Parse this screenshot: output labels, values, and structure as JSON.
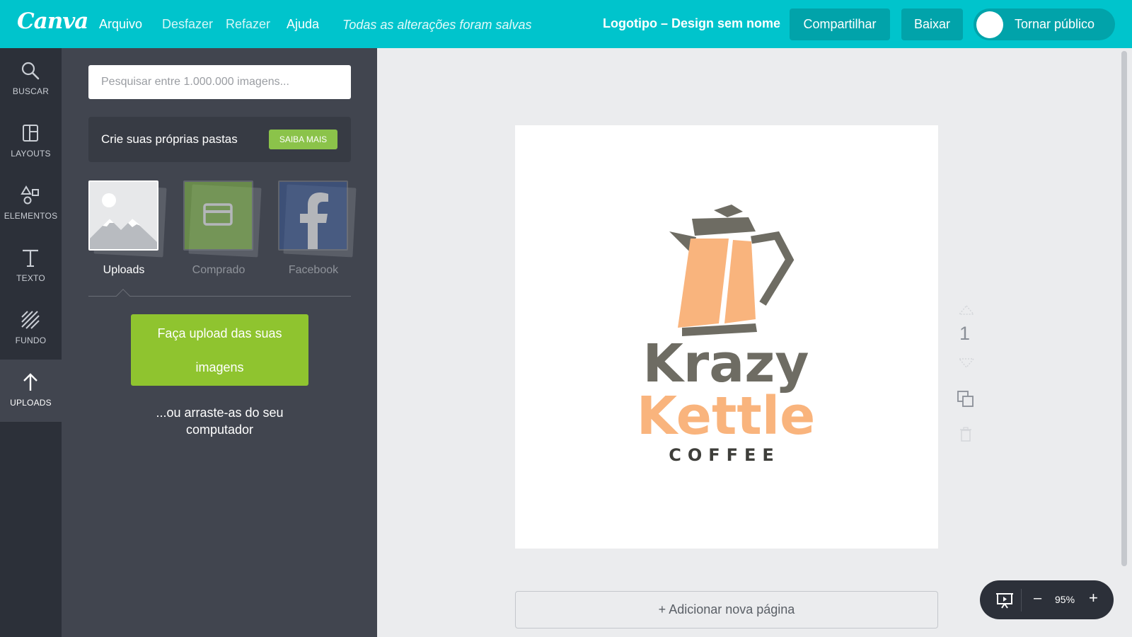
{
  "brand": {
    "logo_text": "Canva"
  },
  "topbar": {
    "menu": [
      "Arquivo",
      "Desfazer",
      "Refazer",
      "Ajuda"
    ],
    "saved_status": "Todas as alterações foram salvas",
    "doc_title": "Logotipo – Design sem nome",
    "share_label": "Compartilhar",
    "download_label": "Baixar",
    "public_toggle_label": "Tornar público",
    "accent_color": "#00c4cc"
  },
  "leftnav": {
    "items": [
      {
        "label": "BUSCAR",
        "icon": "search-icon"
      },
      {
        "label": "LAYOUTS",
        "icon": "layouts-icon"
      },
      {
        "label": "ELEMENTOS",
        "icon": "elements-icon"
      },
      {
        "label": "TEXTO",
        "icon": "text-icon"
      },
      {
        "label": "FUNDO",
        "icon": "background-icon"
      },
      {
        "label": "UPLOADS",
        "icon": "upload-icon",
        "active": true
      }
    ]
  },
  "panel": {
    "search_placeholder": "Pesquisar entre 1.000.000 imagens...",
    "folders_text": "Crie suas próprias pastas",
    "folders_button": "SAIBA MAIS",
    "sources": [
      {
        "label": "Uploads",
        "active": true,
        "icon": "image-placeholder-icon"
      },
      {
        "label": "Comprado",
        "active": false,
        "icon": "credit-card-icon"
      },
      {
        "label": "Facebook",
        "active": false,
        "icon": "facebook-icon"
      }
    ],
    "upload_button_line1": "Faça upload das suas",
    "upload_button_line2": "imagens",
    "drag_line1": "...ou arraste-as  do seu",
    "drag_line2": "computador"
  },
  "canvas": {
    "logo_word1": "Krazy",
    "logo_word2": "Kettle",
    "logo_word3": "COFFEE",
    "logo_gray": "#6e6c63",
    "logo_orange": "#f9b47d",
    "page_number": "1",
    "add_page_label": "+ Adicionar nova página"
  },
  "zoom": {
    "level": "95%",
    "minus": "–",
    "plus": "+"
  }
}
